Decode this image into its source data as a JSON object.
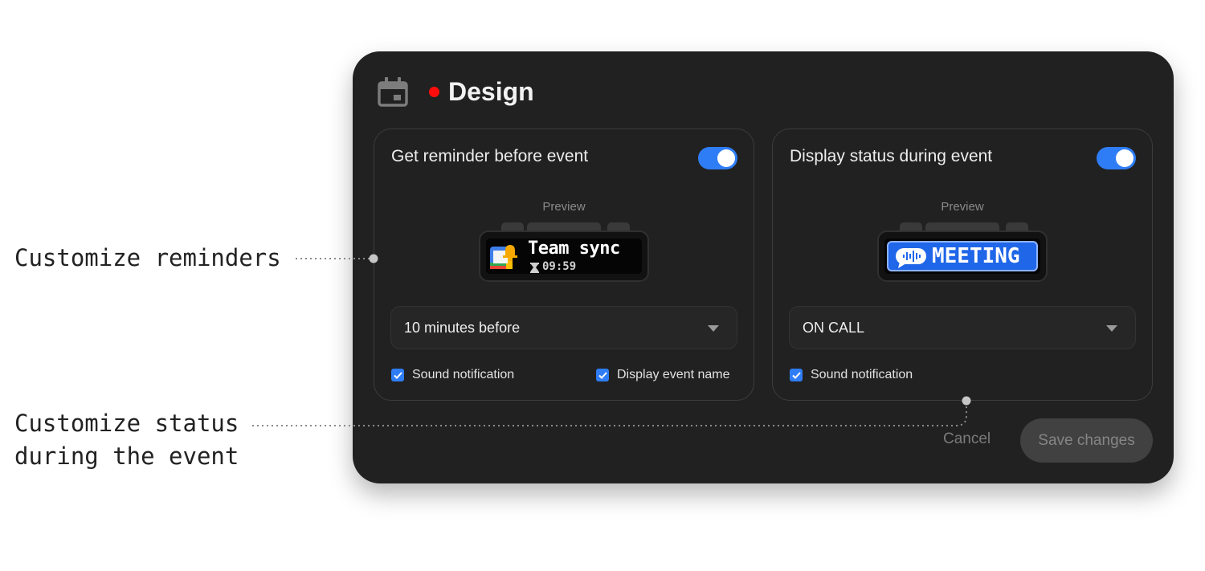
{
  "annotations": {
    "reminders": "Customize reminders",
    "status_line1": "Customize status",
    "status_line2": "during the event"
  },
  "dialog": {
    "icon": "calendar-icon",
    "status_color": "#ff0d0d",
    "title": "Design"
  },
  "reminder_card": {
    "title": "Get reminder before event",
    "toggle_on": true,
    "preview_label": "Preview",
    "device": {
      "event_name": "Team sync",
      "timer": "09:59"
    },
    "select_value": "10 minutes before",
    "checkboxes": [
      {
        "label": "Sound notification",
        "checked": true
      },
      {
        "label": "Display event name",
        "checked": true
      }
    ]
  },
  "status_card": {
    "title": "Display status during event",
    "toggle_on": true,
    "preview_label": "Preview",
    "device": {
      "status_text": "MEETING"
    },
    "select_value": "ON CALL",
    "checkboxes": [
      {
        "label": "Sound notification",
        "checked": true
      }
    ]
  },
  "footer": {
    "cancel_label": "Cancel",
    "save_label": "Save changes"
  },
  "colors": {
    "accent": "#2f7df6",
    "modal_bg": "#212121",
    "status_dot": "#ff0d0d",
    "meeting_blue": "#1f66e8"
  }
}
